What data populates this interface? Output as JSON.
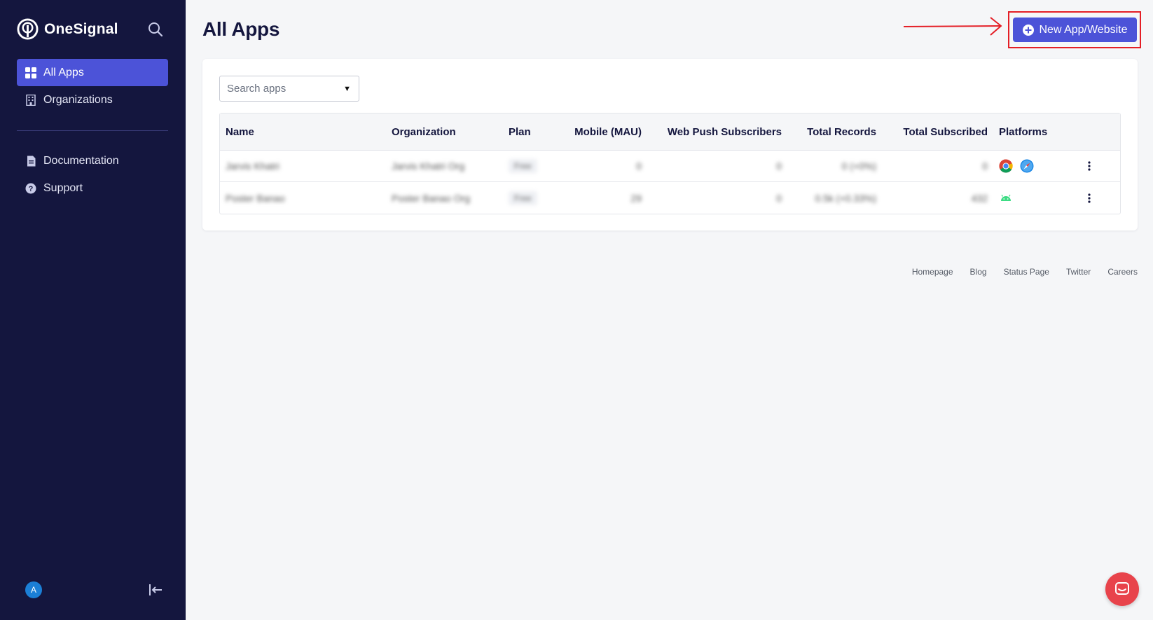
{
  "brand": {
    "name": "OneSignal"
  },
  "sidebar": {
    "primary": [
      {
        "label": "All Apps",
        "icon": "grid-icon",
        "active": true
      },
      {
        "label": "Organizations",
        "icon": "building-icon",
        "active": false
      }
    ],
    "secondary": [
      {
        "label": "Documentation",
        "icon": "document-icon"
      },
      {
        "label": "Support",
        "icon": "help-icon"
      }
    ],
    "avatar_initial": "A"
  },
  "header": {
    "title": "All Apps",
    "new_button_label": "New App/Website"
  },
  "search": {
    "placeholder": "Search apps"
  },
  "table": {
    "columns": [
      "Name",
      "Organization",
      "Plan",
      "Mobile (MAU)",
      "Web Push Subscribers",
      "Total Records",
      "Total Subscribed",
      "Platforms"
    ],
    "rows": [
      {
        "name": "Jarvis Khatri",
        "organization": "Jarvis Khatri Org",
        "plan": "Free",
        "mau": "0",
        "web_push": "0",
        "total_records": "0 (+0%)",
        "total_subscribed": "0",
        "platforms": [
          "chrome-icon",
          "safari-icon"
        ]
      },
      {
        "name": "Poster Banao",
        "organization": "Poster Banao Org",
        "plan": "Free",
        "mau": "29",
        "web_push": "0",
        "total_records": "0.5k (+0.33%)",
        "total_subscribed": "432",
        "platforms": [
          "android-icon"
        ]
      }
    ]
  },
  "footer": {
    "links": [
      "Homepage",
      "Blog",
      "Status Page",
      "Twitter",
      "Careers"
    ]
  },
  "colors": {
    "sidebar_bg": "#14163e",
    "accent": "#4c53d8",
    "annotation": "#e41e26",
    "chat": "#e8434b"
  }
}
